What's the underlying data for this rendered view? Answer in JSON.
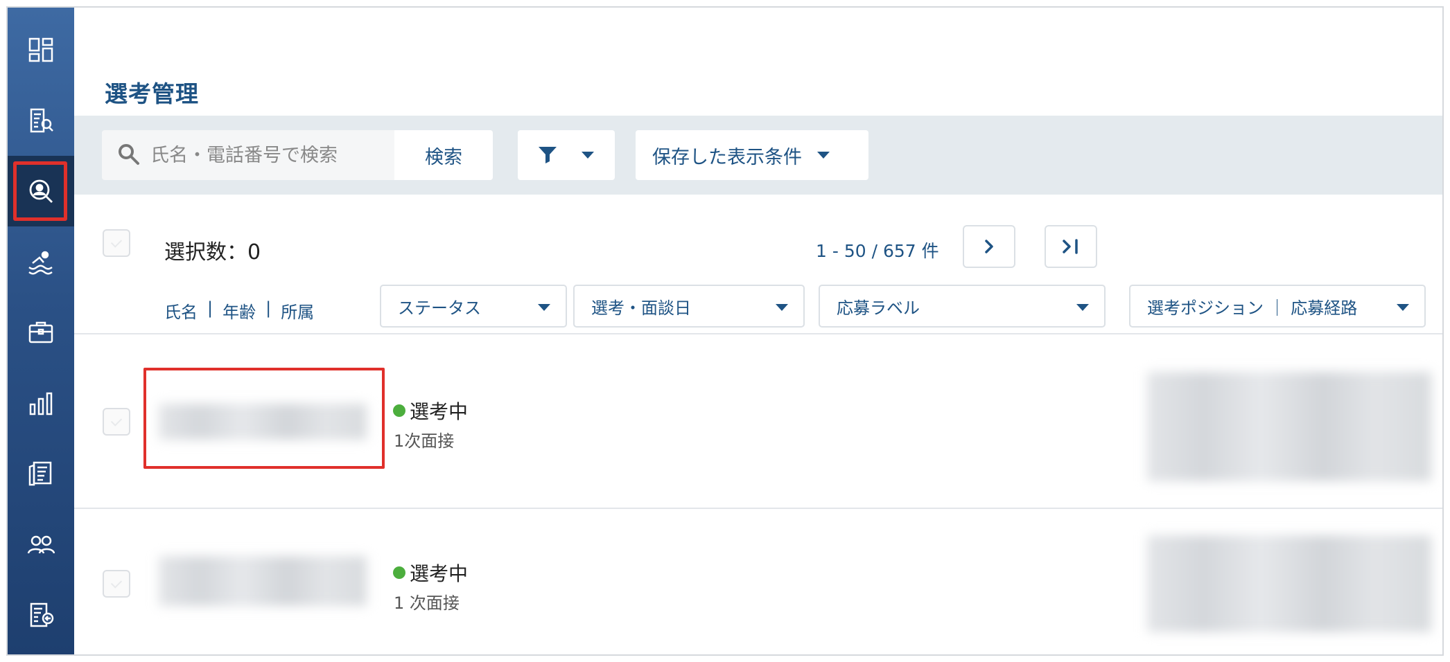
{
  "page": {
    "title": "選考管理"
  },
  "sidebar": {
    "items": [
      {
        "icon": "dashboard-icon"
      },
      {
        "icon": "job-search-icon"
      },
      {
        "icon": "candidate-search-icon",
        "active": true
      },
      {
        "icon": "swimmer-icon"
      },
      {
        "icon": "briefcase-icon"
      },
      {
        "icon": "bar-chart-icon"
      },
      {
        "icon": "documents-icon"
      },
      {
        "icon": "users-icon"
      },
      {
        "icon": "export-list-icon"
      }
    ]
  },
  "search": {
    "placeholder": "氏名・電話番号で検索",
    "button_label": "検索",
    "saved_conditions_label": "保存した表示条件"
  },
  "toolbar": {
    "selected_label": "選択数：0",
    "range_label": "1 - 50 / 657 件",
    "next_glyph": "›",
    "last_glyph": "›|"
  },
  "columns": {
    "sort_name": "氏名",
    "sort_age": "年齢",
    "sort_affiliation": "所属",
    "separator": "|",
    "status": "ステータス",
    "interview_date": "選考・面談日",
    "application_label": "応募ラベル",
    "position_route": "選考ポジション ｜ 応募経路"
  },
  "rows": [
    {
      "status": "選考中",
      "stage": "1次面接"
    },
    {
      "status": "選考中",
      "stage": "1 次面接"
    }
  ],
  "colors": {
    "brand": "#1e5384",
    "sidebar_top": "#3e6aa3",
    "sidebar_bottom": "#1e3f6f",
    "highlight": "#e0302b",
    "status_active": "#4cae3d",
    "search_bar_bg": "#e4eaee"
  }
}
